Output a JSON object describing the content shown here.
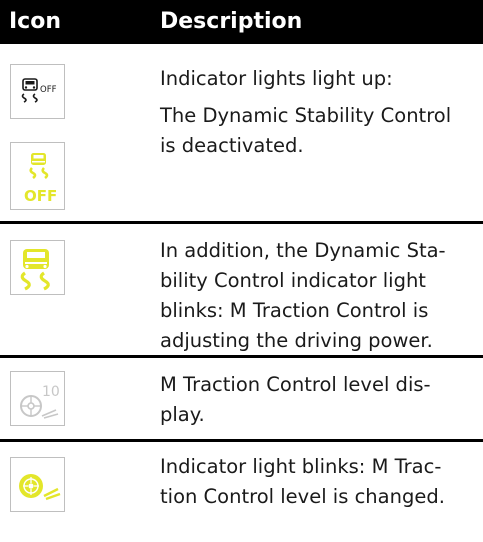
{
  "table": {
    "headers": {
      "icon": "Icon",
      "description": "Description"
    },
    "rows": [
      {
        "icons": [
          "dsc-off-gray-icon",
          "dsc-off-yellow-icon"
        ],
        "lines": [
          "Indicator lights light up:",
          "The Dynamic Stability Control",
          "is deactivated."
        ]
      },
      {
        "icons": [
          "dsc-yellow-icon"
        ],
        "lines": [
          "In addition, the Dynamic Sta-",
          "bility Control indicator light",
          "blinks: M Traction Control is",
          "adjusting the driving power."
        ]
      },
      {
        "icons": [
          "traction-control-level-icon"
        ],
        "lines": [
          "M Traction Control level dis-",
          "play."
        ],
        "icon_text": "10"
      },
      {
        "icons": [
          "traction-control-yellow-icon"
        ],
        "lines": [
          "Indicator light blinks: M Trac-",
          "tion Control level is changed."
        ]
      }
    ],
    "icon_labels": {
      "off": "OFF"
    }
  },
  "colors": {
    "header_bg": "#000000",
    "header_text": "#ffffff",
    "indicator_yellow": "#e3e62a",
    "icon_gray": "#c7c7c7",
    "divider": "#000000"
  }
}
